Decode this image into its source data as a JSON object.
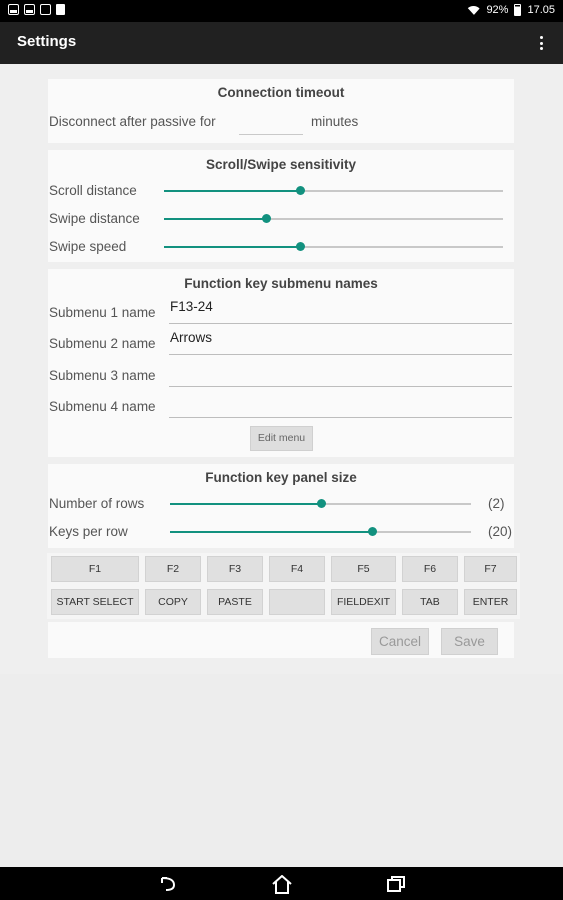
{
  "status_bar": {
    "battery": "92%",
    "time": "17.05"
  },
  "app_bar": {
    "title": "Settings"
  },
  "connection": {
    "title": "Connection timeout",
    "label_before": "Disconnect after passive for",
    "value": "",
    "label_after": "minutes"
  },
  "sensitivity": {
    "title": "Scroll/Swipe sensitivity",
    "sliders": [
      {
        "label": "Scroll distance",
        "level": 0.4
      },
      {
        "label": "Swipe distance",
        "level": 0.3
      },
      {
        "label": "Swipe speed",
        "level": 0.4
      }
    ]
  },
  "submenus": {
    "title": "Function key submenu names",
    "fields": [
      {
        "label": "Submenu 1 name",
        "value": "F13-24"
      },
      {
        "label": "Submenu 2 name",
        "value": "Arrows"
      },
      {
        "label": "Submenu 3 name",
        "value": ""
      },
      {
        "label": "Submenu 4 name",
        "value": ""
      }
    ],
    "edit_button": "Edit menu"
  },
  "panel_size": {
    "title": "Function key panel size",
    "rows": {
      "label": "Number of rows",
      "level": 0.5,
      "value": "(2)"
    },
    "keys": {
      "label": "Keys per row",
      "level": 0.67,
      "value": "(20)"
    }
  },
  "fkeys_row1": [
    "F1",
    "F2",
    "F3",
    "F4",
    "F5",
    "F6",
    "F7"
  ],
  "fkeys_row2": [
    "START SELECT",
    "COPY",
    "PASTE",
    "",
    "FIELDEXIT",
    "TAB",
    "ENTER"
  ],
  "dialog_buttons": {
    "cancel": "Cancel",
    "save": "Save"
  },
  "colors": {
    "accent": "#12917f",
    "appbar": "#212121"
  }
}
